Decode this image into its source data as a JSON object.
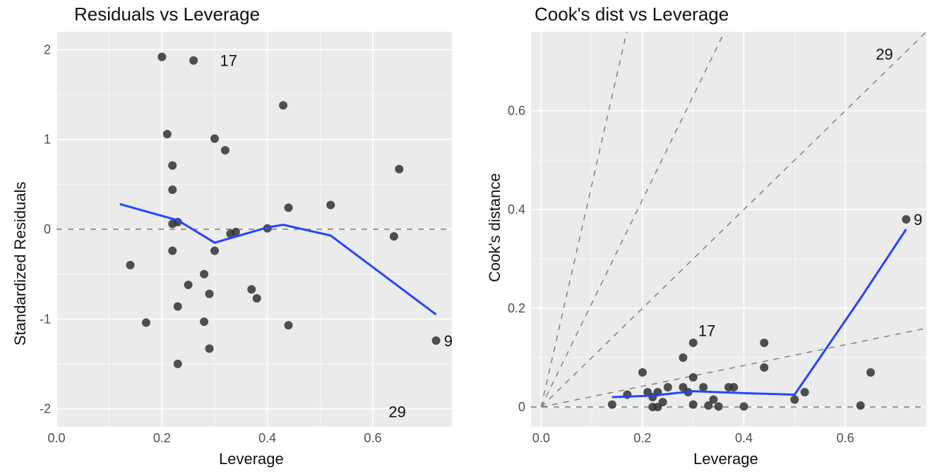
{
  "left": {
    "title": "Residuals vs Leverage",
    "xlabel": "Leverage",
    "ylabel": "Standardized Residuals"
  },
  "right": {
    "title": "Cook's dist vs Leverage",
    "xlabel": "Leverage",
    "ylabel": "Cook's distance"
  },
  "annot": {
    "left_17": "17",
    "left_9": "9",
    "left_29": "29",
    "right_29": "29",
    "right_9": "9",
    "right_17": "17"
  },
  "chart_data": [
    {
      "type": "scatter",
      "title": "Residuals vs Leverage",
      "xlabel": "Leverage",
      "ylabel": "Standardized Residuals",
      "xlim": [
        0.0,
        0.75
      ],
      "ylim": [
        -2.2,
        2.2
      ],
      "x_ticks": [
        0.0,
        0.2,
        0.4,
        0.6
      ],
      "y_ticks": [
        -2,
        -1,
        0,
        1,
        2
      ],
      "ref_lines": [
        {
          "type": "hline",
          "y": 0
        }
      ],
      "smooth_line": {
        "x": [
          0.12,
          0.23,
          0.3,
          0.4,
          0.43,
          0.52,
          0.72
        ],
        "y": [
          0.28,
          0.1,
          -0.15,
          0.02,
          0.05,
          -0.07,
          -0.95
        ]
      },
      "points": [
        {
          "x": 0.2,
          "y": 1.92
        },
        {
          "x": 0.26,
          "y": 1.88,
          "label": "17"
        },
        {
          "x": 0.43,
          "y": 1.38
        },
        {
          "x": 0.21,
          "y": 1.06
        },
        {
          "x": 0.3,
          "y": 1.01
        },
        {
          "x": 0.32,
          "y": 0.88
        },
        {
          "x": 0.22,
          "y": 0.71
        },
        {
          "x": 0.65,
          "y": 0.67
        },
        {
          "x": 0.22,
          "y": 0.44
        },
        {
          "x": 0.52,
          "y": 0.27
        },
        {
          "x": 0.44,
          "y": 0.24
        },
        {
          "x": 0.23,
          "y": 0.08
        },
        {
          "x": 0.22,
          "y": 0.06
        },
        {
          "x": 0.4,
          "y": 0.01
        },
        {
          "x": 0.34,
          "y": -0.03
        },
        {
          "x": 0.33,
          "y": -0.05
        },
        {
          "x": 0.64,
          "y": -0.08
        },
        {
          "x": 0.3,
          "y": -0.24
        },
        {
          "x": 0.22,
          "y": -0.24
        },
        {
          "x": 0.14,
          "y": -0.4
        },
        {
          "x": 0.28,
          "y": -0.5
        },
        {
          "x": 0.25,
          "y": -0.62
        },
        {
          "x": 0.37,
          "y": -0.67
        },
        {
          "x": 0.29,
          "y": -0.72
        },
        {
          "x": 0.38,
          "y": -0.77
        },
        {
          "x": 0.23,
          "y": -0.86
        },
        {
          "x": 0.28,
          "y": -1.03
        },
        {
          "x": 0.17,
          "y": -1.04
        },
        {
          "x": 0.44,
          "y": -1.07
        },
        {
          "x": 0.72,
          "y": -1.24,
          "label": "9"
        },
        {
          "x": 0.29,
          "y": -1.33
        },
        {
          "x": 0.23,
          "y": -1.5
        }
      ],
      "off_plot_labels": [
        {
          "label": "29",
          "x": 0.63,
          "y": -2.03
        }
      ]
    },
    {
      "type": "scatter",
      "title": "Cook's dist vs Leverage",
      "xlabel": "Leverage",
      "ylabel": "Cook's distance",
      "xlim": [
        -0.02,
        0.76
      ],
      "ylim": [
        -0.04,
        0.76
      ],
      "x_ticks": [
        0.0,
        0.2,
        0.4,
        0.6
      ],
      "y_ticks": [
        0.0,
        0.2,
        0.4,
        0.6
      ],
      "ref_lines": [
        {
          "type": "hline",
          "y": 0
        },
        {
          "type": "ray",
          "from": [
            0,
            0
          ],
          "slope": 0.21
        },
        {
          "type": "ray",
          "from": [
            0,
            0
          ],
          "slope": 1.0
        },
        {
          "type": "ray",
          "from": [
            0,
            0
          ],
          "slope": 2.1
        },
        {
          "type": "ray",
          "from": [
            0,
            0
          ],
          "slope": 4.5
        }
      ],
      "smooth_line": {
        "x": [
          0.14,
          0.22,
          0.3,
          0.4,
          0.5,
          0.63,
          0.72
        ],
        "y": [
          0.02,
          0.023,
          0.032,
          0.028,
          0.025,
          0.22,
          0.36
        ]
      },
      "points": [
        {
          "x": 0.72,
          "y": 0.38,
          "label": "9"
        },
        {
          "x": 0.3,
          "y": 0.13,
          "label": "17"
        },
        {
          "x": 0.44,
          "y": 0.13
        },
        {
          "x": 0.28,
          "y": 0.1
        },
        {
          "x": 0.44,
          "y": 0.08
        },
        {
          "x": 0.65,
          "y": 0.07
        },
        {
          "x": 0.2,
          "y": 0.07
        },
        {
          "x": 0.3,
          "y": 0.06
        },
        {
          "x": 0.32,
          "y": 0.04
        },
        {
          "x": 0.28,
          "y": 0.04
        },
        {
          "x": 0.25,
          "y": 0.04
        },
        {
          "x": 0.37,
          "y": 0.04
        },
        {
          "x": 0.38,
          "y": 0.04
        },
        {
          "x": 0.52,
          "y": 0.03
        },
        {
          "x": 0.21,
          "y": 0.03
        },
        {
          "x": 0.29,
          "y": 0.03
        },
        {
          "x": 0.23,
          "y": 0.03
        },
        {
          "x": 0.17,
          "y": 0.025
        },
        {
          "x": 0.22,
          "y": 0.02
        },
        {
          "x": 0.34,
          "y": 0.015
        },
        {
          "x": 0.5,
          "y": 0.015
        },
        {
          "x": 0.24,
          "y": 0.01
        },
        {
          "x": 0.14,
          "y": 0.005
        },
        {
          "x": 0.3,
          "y": 0.005
        },
        {
          "x": 0.33,
          "y": 0.003
        },
        {
          "x": 0.63,
          "y": 0.003
        },
        {
          "x": 0.4,
          "y": 0.001
        },
        {
          "x": 0.35,
          "y": 0.001
        },
        {
          "x": 0.22,
          "y": 0.0
        },
        {
          "x": 0.23,
          "y": 0.0
        }
      ],
      "off_plot_labels": [
        {
          "label": "29",
          "x": 0.68,
          "y": 0.715
        }
      ]
    }
  ]
}
